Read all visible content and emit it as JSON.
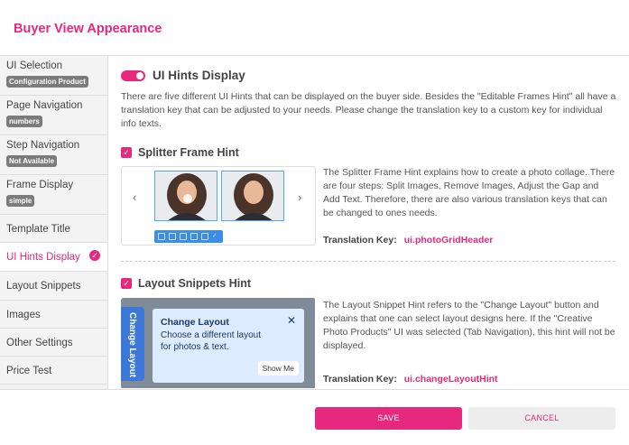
{
  "header": {
    "title": "Buyer View Appearance"
  },
  "sidebar": {
    "items": [
      {
        "label": "UI Selection",
        "badge": "Configuration Product"
      },
      {
        "label": "Page Navigation",
        "badge": "numbers"
      },
      {
        "label": "Step Navigation",
        "badge": "Not Available"
      },
      {
        "label": "Frame Display",
        "badge": "simple"
      },
      {
        "label": "Template Title"
      },
      {
        "label": "UI Hints Display",
        "active": true
      },
      {
        "label": "Layout Snippets"
      },
      {
        "label": "Images"
      },
      {
        "label": "Other Settings"
      },
      {
        "label": "Price Test"
      }
    ]
  },
  "main": {
    "toggle_title": "UI Hints Display",
    "description": "There are five different UI Hints that can be displayed on the buyer side. Besides the \"Editable Frames Hint\" all have a translation key that can be adjusted to your needs. Please change the translation key to a custom key for individual info texts.",
    "splitter": {
      "title": "Splitter Frame Hint",
      "text": "The Splitter Frame Hint explains how to create a photo collage. There are four steps: Split Images, Remove Images, Adjust the Gap and Add Text. Therefore, there are also various translation keys that can be changed to ones needs.",
      "key_label": "Translation Key:",
      "key_value": "ui.photoGridHeader"
    },
    "layout": {
      "title": "Layout Snippets Hint",
      "text": "The Layout Snippet Hint refers to the \"Change Layout\" button and explains that one can select layout designs here. If the \"Creative Photo Products\" UI was selected (Tab Navigation), this hint will not be displayed.",
      "key_label": "Translation Key:",
      "key_value": "ui.changeLayoutHint",
      "preview": {
        "tab_label": "Change Layout",
        "box_title": "Change Layout",
        "box_text": "Choose a different layout for photos & text.",
        "show_me": "Show Me"
      }
    }
  },
  "footer": {
    "save_label": "SAVE",
    "cancel_label": "CANCEL"
  },
  "colors": {
    "accent": "#e6297d",
    "blue": "#3b78d8"
  }
}
